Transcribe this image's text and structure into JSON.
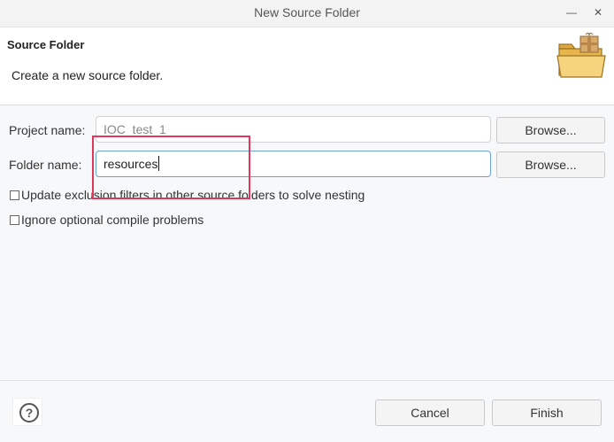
{
  "window": {
    "title": "New Source Folder",
    "minimize_glyph": "—",
    "close_glyph": "✕"
  },
  "header": {
    "title": "Source Folder",
    "description": "Create a new source folder.",
    "icon": "source-folder-package-icon"
  },
  "form": {
    "project_label": "Project name:",
    "project_value": "IOC_test_1",
    "project_browse": "Browse...",
    "folder_label": "Folder name:",
    "folder_value": "resources",
    "folder_browse": "Browse..."
  },
  "options": [
    {
      "label": "Update exclusion filters in other source folders to solve nesting",
      "checked": false
    },
    {
      "label": "Ignore optional compile problems",
      "checked": false
    }
  ],
  "footer": {
    "help_glyph": "?",
    "cancel_label": "Cancel",
    "finish_label": "Finish"
  },
  "colors": {
    "highlight": "#e0375a",
    "focus_border": "#6aa1d8"
  }
}
